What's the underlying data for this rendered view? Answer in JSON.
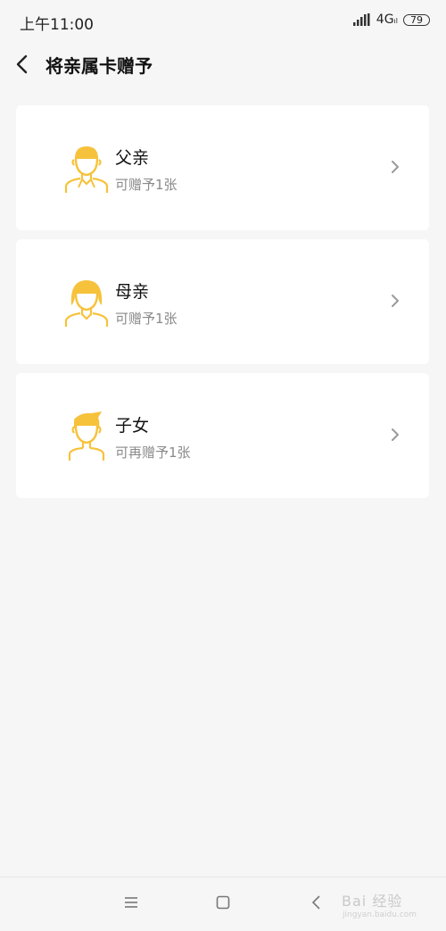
{
  "status_bar": {
    "time": "上午11:00",
    "network": "4G",
    "battery": "79"
  },
  "header": {
    "title": "将亲属卡赠予"
  },
  "cards": [
    {
      "title": "父亲",
      "subtitle": "可赠予1张",
      "icon": "father-avatar-icon"
    },
    {
      "title": "母亲",
      "subtitle": "可赠予1张",
      "icon": "mother-avatar-icon"
    },
    {
      "title": "子女",
      "subtitle": "可再赠予1张",
      "icon": "child-avatar-icon"
    }
  ],
  "watermark": {
    "text": "Bai 经验",
    "url_text": "jingyan.baidu.com"
  },
  "colors": {
    "accent": "#f7c23b",
    "background": "#f6f6f6",
    "subtitle": "#8a8a8a"
  }
}
